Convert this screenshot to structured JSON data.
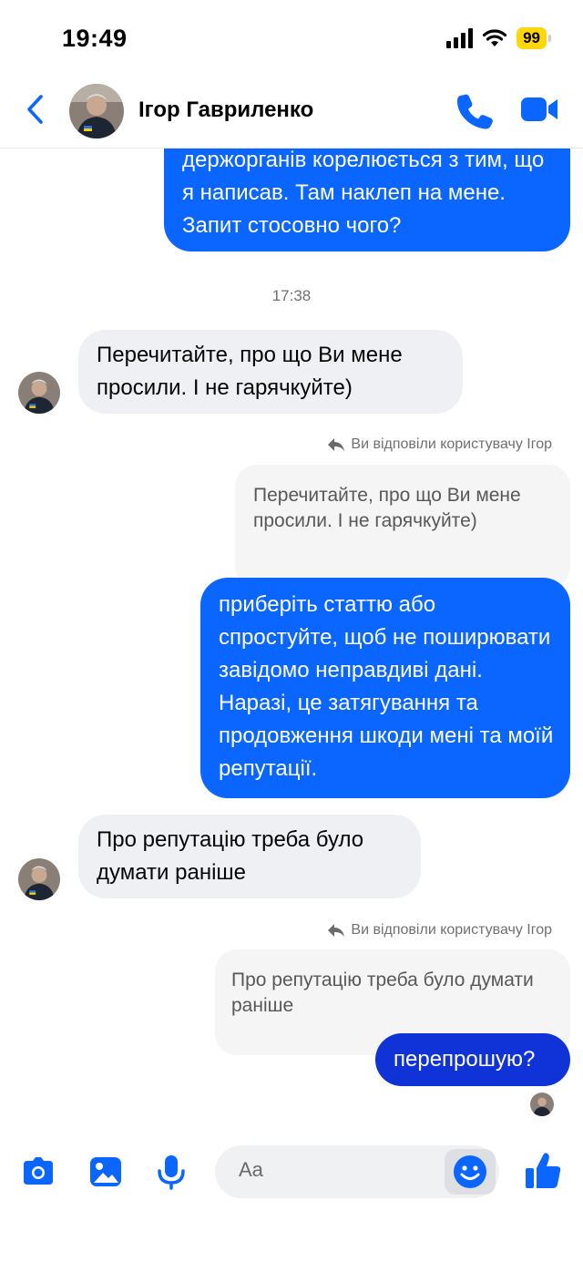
{
  "status_bar": {
    "time": "19:49",
    "battery": "99"
  },
  "header": {
    "contact_name": "Ігор Гавриленко"
  },
  "messages": {
    "m1_text": "держорганів корелюється з тим, що я написав. Там наклеп на мене. Запит стосовно чого?",
    "timestamp": "17:38",
    "m2_text": "Перечитайте, про що Ви мене просили. І не гарячкуйте)",
    "reply_note_1": "Ви відповіли користувачу Ігор",
    "quote_1": "Перечитайте, про що Ви мене просили. І не гарячкуйте)",
    "m3_text": "приберіть статтю або спростуйте, щоб не поширювати завідомо неправдиві дані. Наразі, це затягування та продовження шкоди мені та моїй репутації.",
    "m4_text": "Про репутацію треба було думати раніше",
    "reply_note_2": "Ви відповіли користувачу Ігор",
    "quote_2": "Про репутацію треба було думати раніше",
    "m5_text": "перепрошую?"
  },
  "composer": {
    "placeholder": "Aa"
  },
  "colors": {
    "accent": "#0a66ff",
    "outgoing_dark": "#1033d8",
    "incoming": "#eff0f3",
    "battery": "#ffd60a"
  },
  "icons": [
    "back-chevron-icon",
    "phone-icon",
    "video-icon",
    "camera-icon",
    "gallery-icon",
    "microphone-icon",
    "emoji-icon",
    "thumbs-up-icon",
    "reply-arrow-icon"
  ]
}
